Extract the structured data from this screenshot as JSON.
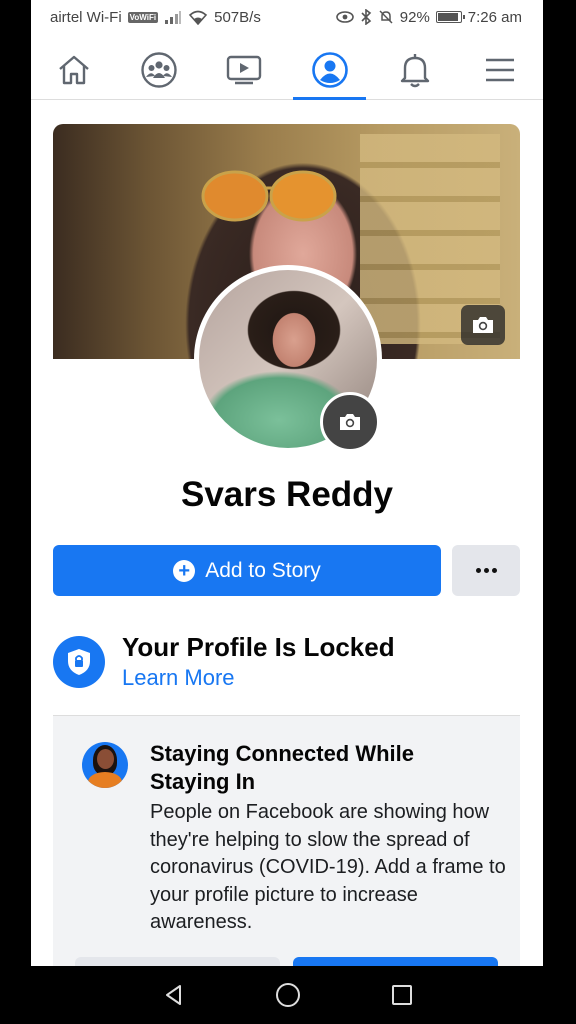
{
  "status_bar": {
    "carrier": "airtel Wi-Fi",
    "volte_badge": "VoWiFi",
    "network_speed": "507B/s",
    "battery_percent": "92%",
    "battery_level": 0.92,
    "time": "7:26 am"
  },
  "nav": {
    "tabs": [
      {
        "icon": "home-icon",
        "active": false
      },
      {
        "icon": "groups-icon",
        "active": false
      },
      {
        "icon": "watch-icon",
        "active": false
      },
      {
        "icon": "profile-icon",
        "active": true
      },
      {
        "icon": "bell-icon",
        "active": false
      },
      {
        "icon": "menu-icon",
        "active": false
      }
    ],
    "accent": "#1877f2"
  },
  "profile": {
    "name": "Svars Reddy",
    "add_story_label": "Add to Story",
    "more_label": "..."
  },
  "locked": {
    "title": "Your Profile Is Locked",
    "link": "Learn More"
  },
  "covid_card": {
    "title": "Staying Connected While Staying In",
    "text": "People on Facebook are showing how they're helping to slow the spread of coronavirus (COVID-19). Add a frame to your profile picture to increase awareness."
  },
  "android_nav": [
    "back-icon",
    "home-circle-icon",
    "recents-icon"
  ]
}
